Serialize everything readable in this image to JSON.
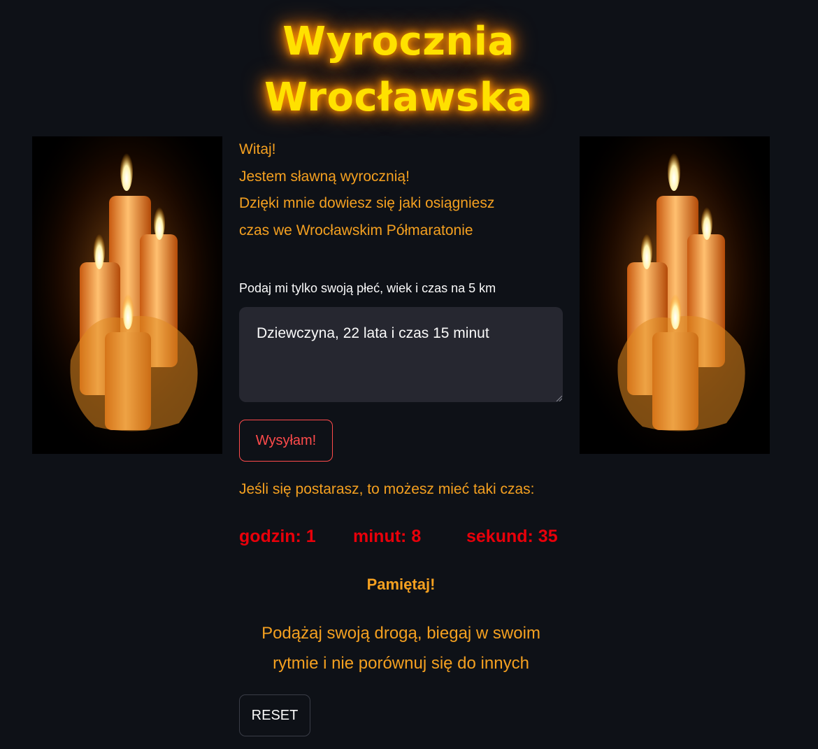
{
  "header": {
    "title_line1": "Wyrocznia",
    "title_line2": "Wrocławska"
  },
  "intro": {
    "lines": [
      "Witaj!",
      "Jestem sławną wyrocznią!",
      "Dzięki mnie dowiesz się jaki osiągniesz",
      "czas we Wrocławskim Półmaratonie"
    ]
  },
  "form": {
    "label": "Podaj mi tylko swoją płeć, wiek i czas na 5 km",
    "input_value": "Dziewczyna, 22 lata i czas 15 minut",
    "submit_label": "Wysyłam!"
  },
  "result": {
    "intro": "Jeśli się postarasz, to możesz mieć taki czas:",
    "hours_text": "godzin: 1",
    "minutes_text": "minut: 8",
    "seconds_text": "sekund: 35"
  },
  "advice": {
    "heading": "Pamiętaj!",
    "line1": "Podążaj swoją drogą, biegaj w swoim",
    "line2": "rytmie i nie porównuj się do innych"
  },
  "reset_label": "RESET",
  "images": {
    "left": "candles-image",
    "right": "candles-image"
  },
  "colors": {
    "background": "#0e1117",
    "title": "#ffe100",
    "text_orange": "#f4a020",
    "result_red": "#e8000a",
    "button_red": "#ff4b4b",
    "input_bg": "#262730"
  }
}
